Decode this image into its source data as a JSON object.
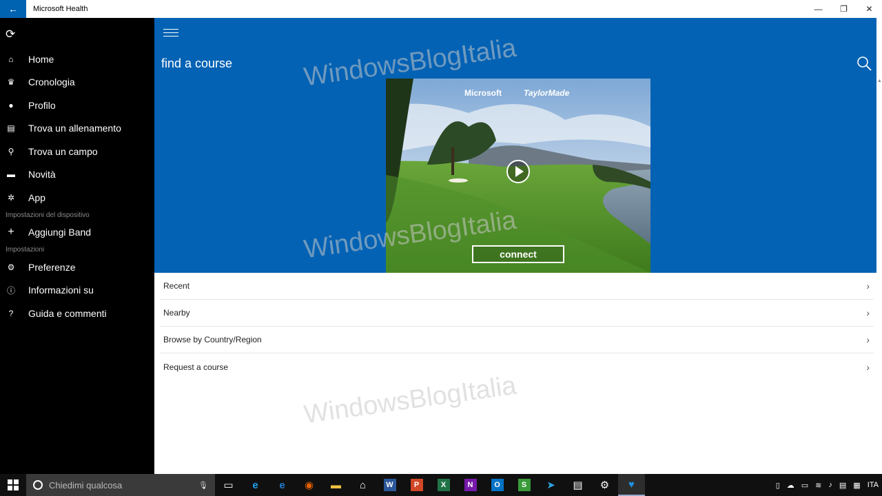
{
  "window": {
    "title": "Microsoft Health",
    "back_glyph": "←",
    "minimize": "—",
    "restore": "❐",
    "close": "✕"
  },
  "sidebar": {
    "items": [
      {
        "label": "Home",
        "icon": "home-icon"
      },
      {
        "label": "Cronologia",
        "icon": "trophy-icon"
      },
      {
        "label": "Profilo",
        "icon": "person-icon"
      },
      {
        "label": "Trova un allenamento",
        "icon": "workout-icon"
      },
      {
        "label": "Trova un campo",
        "icon": "golf-tee-icon"
      },
      {
        "label": "Novità",
        "icon": "message-icon"
      },
      {
        "label": "App",
        "icon": "apps-icon"
      }
    ],
    "device_section": "Impostazioni del dispositivo",
    "add_band": "Aggiungi Band",
    "settings_section": "Impostazioni",
    "settings_items": [
      {
        "label": "Preferenze",
        "icon": "gear-icon"
      },
      {
        "label": "Informazioni su",
        "icon": "info-icon"
      },
      {
        "label": "Guida e commenti",
        "icon": "help-icon"
      }
    ]
  },
  "main": {
    "page_title": "find a course",
    "banner": {
      "brand_microsoft": "Microsoft",
      "brand_partner": "TaylorMade",
      "connect_label": "connect"
    },
    "list": [
      "Recent",
      "Nearby",
      "Browse by Country/Region",
      "Request a course"
    ]
  },
  "watermark": "WindowsBlogItalia",
  "taskbar": {
    "search_placeholder": "Chiedimi qualcosa",
    "language": "ITA",
    "apps": [
      {
        "name": "task-view-icon",
        "glyph": "▭",
        "color": "#ffffff"
      },
      {
        "name": "internet-explorer-icon",
        "glyph": "e",
        "color": "#1ea1f1"
      },
      {
        "name": "edge-icon",
        "glyph": "e",
        "color": "#1e7fd1"
      },
      {
        "name": "firefox-icon",
        "glyph": "◉",
        "color": "#e66000"
      },
      {
        "name": "file-explorer-icon",
        "glyph": "▬",
        "color": "#f0c040"
      },
      {
        "name": "store-icon",
        "glyph": "⌂",
        "color": "#ffffff"
      },
      {
        "name": "word-icon",
        "glyph": "W",
        "color": "#2b579a"
      },
      {
        "name": "powerpoint-icon",
        "glyph": "P",
        "color": "#d24726"
      },
      {
        "name": "excel-icon",
        "glyph": "X",
        "color": "#217346"
      },
      {
        "name": "onenote-icon",
        "glyph": "N",
        "color": "#7719aa"
      },
      {
        "name": "outlook-icon",
        "glyph": "O",
        "color": "#0072c6"
      },
      {
        "name": "sway-icon",
        "glyph": "S",
        "color": "#3a9a3a"
      },
      {
        "name": "telegram-icon",
        "glyph": "➤",
        "color": "#2ca5e0"
      },
      {
        "name": "news-icon",
        "glyph": "▤",
        "color": "#ffffff"
      },
      {
        "name": "settings-icon",
        "glyph": "⚙",
        "color": "#ffffff"
      },
      {
        "name": "health-icon",
        "glyph": "♥",
        "color": "#1e8fe0"
      }
    ]
  },
  "colors": {
    "accent": "#0462b4",
    "sidebar": "#000000",
    "taskbar": "#101010"
  }
}
